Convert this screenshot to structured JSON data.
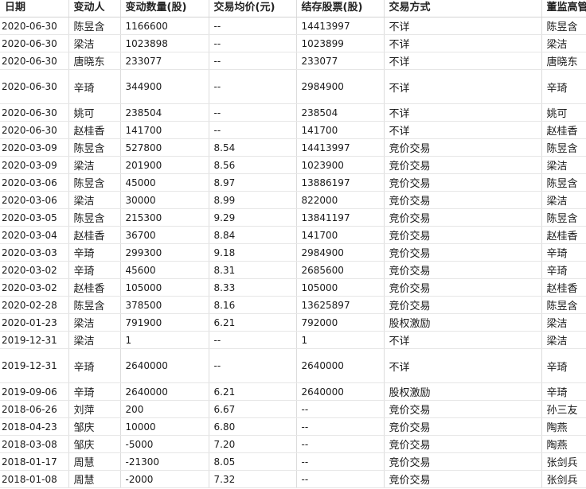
{
  "headers": [
    "日期",
    "变动人",
    "变动数量(股)",
    "交易均价(元)",
    "结存股票(股)",
    "交易方式",
    "董监高管"
  ],
  "rows": [
    {
      "date": "2020-06-30",
      "person": "陈昱含",
      "qty": "1166600",
      "price": "--",
      "held": "14413997",
      "method": "不详",
      "manager": "陈昱含",
      "tall": false
    },
    {
      "date": "2020-06-30",
      "person": "梁洁",
      "qty": "1023898",
      "price": "--",
      "held": "1023899",
      "method": "不详",
      "manager": "梁洁",
      "tall": false
    },
    {
      "date": "2020-06-30",
      "person": "唐晓东",
      "qty": "233077",
      "price": "--",
      "held": "233077",
      "method": "不详",
      "manager": "唐晓东",
      "tall": false
    },
    {
      "date": "2020-06-30",
      "person": "辛琦",
      "qty": "344900",
      "price": "--",
      "held": "2984900",
      "method": "不详",
      "manager": "辛琦",
      "tall": true
    },
    {
      "date": "2020-06-30",
      "person": "姚可",
      "qty": "238504",
      "price": "--",
      "held": "238504",
      "method": "不详",
      "manager": "姚可",
      "tall": false
    },
    {
      "date": "2020-06-30",
      "person": "赵桂香",
      "qty": "141700",
      "price": "--",
      "held": "141700",
      "method": "不详",
      "manager": "赵桂香",
      "tall": false
    },
    {
      "date": "2020-03-09",
      "person": "陈昱含",
      "qty": "527800",
      "price": "8.54",
      "held": "14413997",
      "method": "竞价交易",
      "manager": "陈昱含",
      "tall": false
    },
    {
      "date": "2020-03-09",
      "person": "梁洁",
      "qty": "201900",
      "price": "8.56",
      "held": "1023900",
      "method": "竞价交易",
      "manager": "梁洁",
      "tall": false
    },
    {
      "date": "2020-03-06",
      "person": "陈昱含",
      "qty": "45000",
      "price": "8.97",
      "held": "13886197",
      "method": "竞价交易",
      "manager": "陈昱含",
      "tall": false
    },
    {
      "date": "2020-03-06",
      "person": "梁洁",
      "qty": "30000",
      "price": "8.99",
      "held": "822000",
      "method": "竞价交易",
      "manager": "梁洁",
      "tall": false
    },
    {
      "date": "2020-03-05",
      "person": "陈昱含",
      "qty": "215300",
      "price": "9.29",
      "held": "13841197",
      "method": "竞价交易",
      "manager": "陈昱含",
      "tall": false
    },
    {
      "date": "2020-03-04",
      "person": "赵桂香",
      "qty": "36700",
      "price": "8.84",
      "held": "141700",
      "method": "竞价交易",
      "manager": "赵桂香",
      "tall": false
    },
    {
      "date": "2020-03-03",
      "person": "辛琦",
      "qty": "299300",
      "price": "9.18",
      "held": "2984900",
      "method": "竞价交易",
      "manager": "辛琦",
      "tall": false
    },
    {
      "date": "2020-03-02",
      "person": "辛琦",
      "qty": "45600",
      "price": "8.31",
      "held": "2685600",
      "method": "竞价交易",
      "manager": "辛琦",
      "tall": false
    },
    {
      "date": "2020-03-02",
      "person": "赵桂香",
      "qty": "105000",
      "price": "8.33",
      "held": "105000",
      "method": "竞价交易",
      "manager": "赵桂香",
      "tall": false
    },
    {
      "date": "2020-02-28",
      "person": "陈昱含",
      "qty": "378500",
      "price": "8.16",
      "held": "13625897",
      "method": "竞价交易",
      "manager": "陈昱含",
      "tall": false
    },
    {
      "date": "2020-01-23",
      "person": "梁洁",
      "qty": "791900",
      "price": "6.21",
      "held": "792000",
      "method": "股权激励",
      "manager": "梁洁",
      "tall": false
    },
    {
      "date": "2019-12-31",
      "person": "梁洁",
      "qty": "1",
      "price": "--",
      "held": "1",
      "method": "不详",
      "manager": "梁洁",
      "tall": false
    },
    {
      "date": "2019-12-31",
      "person": "辛琦",
      "qty": "2640000",
      "price": "--",
      "held": "2640000",
      "method": "不详",
      "manager": "辛琦",
      "tall": true
    },
    {
      "date": "2019-09-06",
      "person": "辛琦",
      "qty": "2640000",
      "price": "6.21",
      "held": "2640000",
      "method": "股权激励",
      "manager": "辛琦",
      "tall": false
    },
    {
      "date": "2018-06-26",
      "person": "刘萍",
      "qty": "200",
      "price": "6.67",
      "held": "--",
      "method": "竞价交易",
      "manager": "孙三友",
      "tall": false
    },
    {
      "date": "2018-04-23",
      "person": "邹庆",
      "qty": "10000",
      "price": "6.80",
      "held": "--",
      "method": "竞价交易",
      "manager": "陶燕",
      "tall": false
    },
    {
      "date": "2018-03-08",
      "person": "邹庆",
      "qty": "-5000",
      "price": "7.20",
      "held": "--",
      "method": "竞价交易",
      "manager": "陶燕",
      "tall": false
    },
    {
      "date": "2018-01-17",
      "person": "周慧",
      "qty": "-21300",
      "price": "8.05",
      "held": "--",
      "method": "竞价交易",
      "manager": "张剑兵",
      "tall": false
    },
    {
      "date": "2018-01-08",
      "person": "周慧",
      "qty": "-2000",
      "price": "7.32",
      "held": "--",
      "method": "竞价交易",
      "manager": "张剑兵",
      "tall": false
    }
  ]
}
